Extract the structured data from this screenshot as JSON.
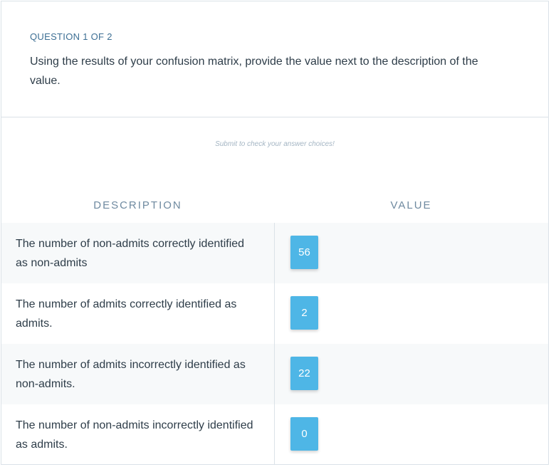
{
  "question": {
    "counter": "QUESTION 1 OF 2",
    "text": "Using the results of your confusion matrix, provide the value next to the description of the value."
  },
  "submit_hint": "Submit to check your answer choices!",
  "table": {
    "headers": {
      "description": "DESCRIPTION",
      "value": "VALUE"
    },
    "rows": [
      {
        "description": "The number of non-admits correctly identified as non-admits",
        "value": "56"
      },
      {
        "description": "The number of admits correctly identified as admits.",
        "value": "2"
      },
      {
        "description": "The number of admits incorrectly identified as non-admits.",
        "value": "22"
      },
      {
        "description": "The number of non-admits incorrectly identified as admits.",
        "value": "0"
      }
    ]
  },
  "colors": {
    "chip": "#4eb6e6",
    "header": "#6f8aa0",
    "counter": "#3d6f94",
    "row_shade": "#f7f9fa"
  }
}
